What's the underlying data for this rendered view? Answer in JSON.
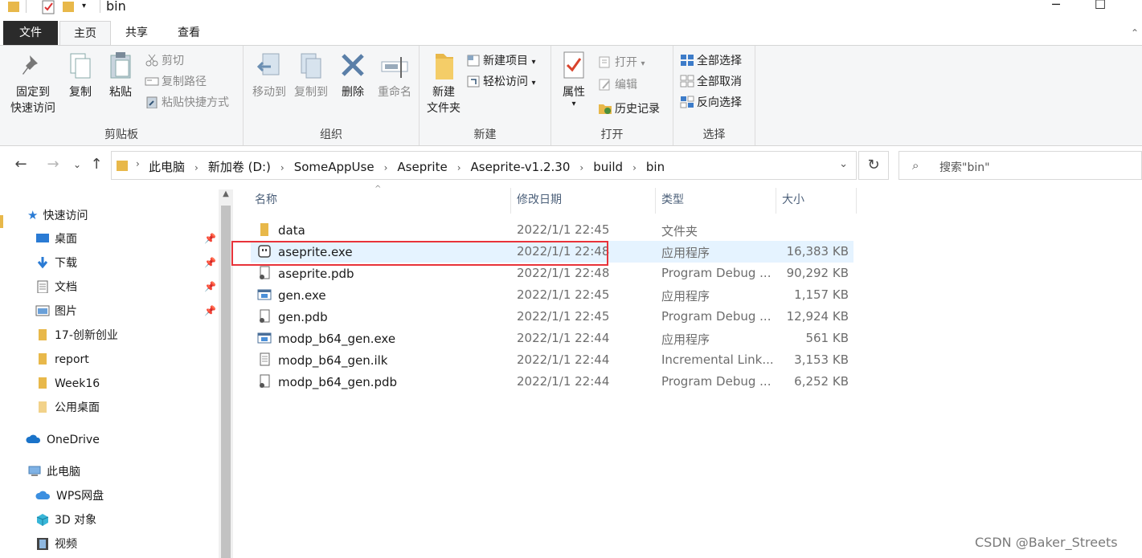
{
  "window": {
    "title": "bin"
  },
  "ribbon_tabs": [
    "文件",
    "主页",
    "共享",
    "查看"
  ],
  "ribbon": {
    "clipboard": {
      "label": "剪贴板",
      "pin": "固定到\n快速访问",
      "pin_l1": "固定到",
      "pin_l2": "快速访问",
      "copy": "复制",
      "paste": "粘贴",
      "cut": "剪切",
      "copy_path": "复制路径",
      "paste_shortcut": "粘贴快捷方式"
    },
    "organize": {
      "label": "组织",
      "move_to": "移动到",
      "copy_to": "复制到",
      "delete": "删除",
      "rename": "重命名"
    },
    "new": {
      "label": "新建",
      "new_folder_l1": "新建",
      "new_folder_l2": "文件夹",
      "new_item": "新建项目",
      "easy_access": "轻松访问"
    },
    "open": {
      "label": "打开",
      "properties": "属性",
      "open": "打开",
      "edit": "编辑",
      "history": "历史记录"
    },
    "select": {
      "label": "选择",
      "select_all": "全部选择",
      "select_none": "全部取消",
      "invert": "反向选择"
    }
  },
  "address": {
    "crumbs": [
      "此电脑",
      "新加卷 (D:)",
      "SomeAppUse",
      "Aseprite",
      "Aseprite-v1.2.30",
      "build",
      "bin"
    ]
  },
  "search": {
    "placeholder": "搜索\"bin\""
  },
  "nav": {
    "quick_access": "快速访问",
    "items": [
      "桌面",
      "下载",
      "文档",
      "图片",
      "17-创新创业",
      "report",
      "Week16",
      "公用桌面"
    ],
    "onedrive": "OneDrive",
    "this_pc": "此电脑",
    "pc_items": [
      "WPS网盘",
      "3D 对象",
      "视频"
    ]
  },
  "columns": {
    "name": "名称",
    "modified": "修改日期",
    "type": "类型",
    "size": "大小"
  },
  "files": [
    {
      "name": "data",
      "modified": "2022/1/1 22:45",
      "type": "文件夹",
      "size": ""
    },
    {
      "name": "aseprite.exe",
      "modified": "2022/1/1 22:48",
      "type": "应用程序",
      "size": "16,383 KB"
    },
    {
      "name": "aseprite.pdb",
      "modified": "2022/1/1 22:48",
      "type": "Program Debug ...",
      "size": "90,292 KB"
    },
    {
      "name": "gen.exe",
      "modified": "2022/1/1 22:45",
      "type": "应用程序",
      "size": "1,157 KB"
    },
    {
      "name": "gen.pdb",
      "modified": "2022/1/1 22:45",
      "type": "Program Debug ...",
      "size": "12,924 KB"
    },
    {
      "name": "modp_b64_gen.exe",
      "modified": "2022/1/1 22:44",
      "type": "应用程序",
      "size": "561 KB"
    },
    {
      "name": "modp_b64_gen.ilk",
      "modified": "2022/1/1 22:44",
      "type": "Incremental Link...",
      "size": "3,153 KB"
    },
    {
      "name": "modp_b64_gen.pdb",
      "modified": "2022/1/1 22:44",
      "type": "Program Debug ...",
      "size": "6,252 KB"
    }
  ],
  "watermark": "CSDN @Baker_Streets",
  "colors": {
    "selection": "#e5f3ff",
    "highlight_box": "#e8333a",
    "folder": "#e8b84a",
    "accent": "#1a73c9"
  }
}
